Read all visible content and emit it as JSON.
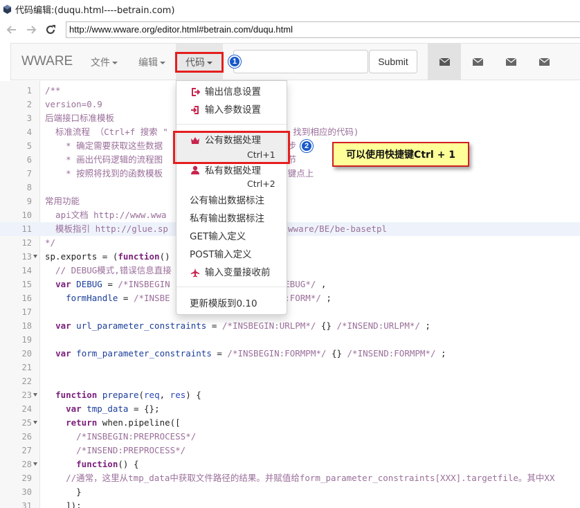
{
  "window": {
    "title": "代码编辑:(duqu.html----betrain.com)"
  },
  "browser": {
    "url": "http://www.wware.org/editor.html#betrain.com/duqu.html"
  },
  "navbar": {
    "brand": "WWARE",
    "menus": [
      "文件",
      "编辑",
      "代码"
    ],
    "search_value": "",
    "submit_label": "Submit",
    "icons": [
      "envelope-icon",
      "envelope-icon",
      "envelope-icon",
      "envelope-icon"
    ]
  },
  "dropdown": {
    "items": [
      {
        "label": "输出信息设置",
        "icon": "sign-out-icon",
        "shortcut": ""
      },
      {
        "label": "输入参数设置",
        "icon": "sign-in-icon",
        "shortcut": ""
      },
      {
        "label": "公有数据处理",
        "icon": "queen-icon",
        "shortcut": "Ctrl+1"
      },
      {
        "label": "私有数据处理",
        "icon": "user-icon",
        "shortcut": "Ctrl+2"
      },
      {
        "label": "公有输出数据标注",
        "icon": "",
        "shortcut": ""
      },
      {
        "label": "私有输出数据标注",
        "icon": "",
        "shortcut": ""
      },
      {
        "label": "GET输入定义",
        "icon": "",
        "shortcut": ""
      },
      {
        "label": "POST输入定义",
        "icon": "",
        "shortcut": ""
      },
      {
        "label": "输入变量接收前",
        "icon": "plane-icon",
        "shortcut": ""
      },
      {
        "label": "更新模版到0.10",
        "icon": "",
        "shortcut": ""
      }
    ]
  },
  "annotations": {
    "badge1": "1",
    "badge2": "2",
    "tip": "可以使用快捷键Ctrl + 1"
  },
  "editor": {
    "highlighted_line": 11,
    "lines": [
      {
        "n": "1",
        "parts": [
          [
            "c-comment",
            "/**"
          ]
        ]
      },
      {
        "n": "2",
        "parts": [
          [
            "c-comment",
            "version=0.9"
          ]
        ]
      },
      {
        "n": "3",
        "parts": [
          [
            "c-comment",
            "后端接口标准模板"
          ]
        ]
      },
      {
        "n": "4",
        "parts": [
          [
            "c-comment",
            "  标准流程 （Ctrl+f 搜索 \"                      \" 找到相应的代码)"
          ]
        ]
      },
      {
        "n": "5",
        "parts": [
          [
            "c-comment",
            "    * 确定需要获取这些数据                        步"
          ]
        ]
      },
      {
        "n": "6",
        "parts": [
          [
            "c-comment",
            "    * 画出代码逻辑的流程图                        节"
          ]
        ]
      },
      {
        "n": "7",
        "parts": [
          [
            "c-comment",
            "    * 按照将找到的函数模板                        键点上"
          ]
        ]
      },
      {
        "n": "8",
        "parts": [
          [
            "c-comment",
            ""
          ]
        ]
      },
      {
        "n": "9",
        "parts": [
          [
            "c-comment",
            "常用功能"
          ]
        ]
      },
      {
        "n": "10",
        "parts": [
          [
            "c-comment",
            "  api文档 http://www.wwa                    ml"
          ]
        ]
      },
      {
        "n": "11",
        "parts": [
          [
            "c-comment",
            "  模板指引 http://glue.sp                    ki/wware/BE/be-basetpl"
          ]
        ]
      },
      {
        "n": "12",
        "parts": [
          [
            "c-comment",
            "*/"
          ]
        ]
      },
      {
        "n": "13",
        "fold": true,
        "parts": [
          [
            "c-plain",
            "sp.exports = ("
          ],
          [
            "c-kw",
            "function"
          ],
          [
            "c-plain",
            "()"
          ]
        ]
      },
      {
        "n": "14",
        "parts": [
          [
            "c-comment",
            "  // DEBUG模式,错误信息直接"
          ]
        ]
      },
      {
        "n": "15",
        "parts": [
          [
            "c-plain",
            "  "
          ],
          [
            "c-kw",
            "var"
          ],
          [
            "c-plain",
            " "
          ],
          [
            "c-def",
            "DEBUG"
          ],
          [
            "c-plain",
            " = "
          ],
          [
            "c-comment",
            "/*INSBEGIN                 END:DEBUG*/"
          ],
          [
            "c-plain",
            " ,"
          ]
        ]
      },
      {
        "n": "16",
        "parts": [
          [
            "c-plain",
            "    "
          ],
          [
            "c-def",
            "formHandle"
          ],
          [
            "c-plain",
            " = "
          ],
          [
            "c-comment",
            "/*INSBE                 NSEND:FORM*/"
          ],
          [
            "c-plain",
            " ;"
          ]
        ]
      },
      {
        "n": "17",
        "parts": [
          [
            "c-plain",
            ""
          ]
        ]
      },
      {
        "n": "18",
        "parts": [
          [
            "c-plain",
            "  "
          ],
          [
            "c-kw",
            "var"
          ],
          [
            "c-plain",
            " "
          ],
          [
            "c-def",
            "url_parameter_constraints"
          ],
          [
            "c-plain",
            " = "
          ],
          [
            "c-comment",
            "/*INSBEGIN:URLPM*/"
          ],
          [
            "c-plain",
            " {} "
          ],
          [
            "c-comment",
            "/*INSEND:URLPM*/"
          ],
          [
            "c-plain",
            " ;"
          ]
        ]
      },
      {
        "n": "19",
        "parts": [
          [
            "c-plain",
            ""
          ]
        ]
      },
      {
        "n": "20",
        "parts": [
          [
            "c-plain",
            "  "
          ],
          [
            "c-kw",
            "var"
          ],
          [
            "c-plain",
            " "
          ],
          [
            "c-def",
            "form_parameter_constraints"
          ],
          [
            "c-plain",
            " = "
          ],
          [
            "c-comment",
            "/*INSBEGIN:FORMPM*/"
          ],
          [
            "c-plain",
            " {} "
          ],
          [
            "c-comment",
            "/*INSEND:FORMPM*/"
          ],
          [
            "c-plain",
            " ;"
          ]
        ]
      },
      {
        "n": "21",
        "parts": [
          [
            "c-plain",
            ""
          ]
        ]
      },
      {
        "n": "22",
        "parts": [
          [
            "c-plain",
            ""
          ]
        ]
      },
      {
        "n": "23",
        "fold": true,
        "parts": [
          [
            "c-plain",
            "  "
          ],
          [
            "c-kw",
            "function"
          ],
          [
            "c-plain",
            " "
          ],
          [
            "c-def",
            "prepare"
          ],
          [
            "c-plain",
            "("
          ],
          [
            "c-var",
            "req"
          ],
          [
            "c-plain",
            ", "
          ],
          [
            "c-var",
            "res"
          ],
          [
            "c-plain",
            ") {"
          ]
        ]
      },
      {
        "n": "24",
        "parts": [
          [
            "c-plain",
            "    "
          ],
          [
            "c-kw",
            "var"
          ],
          [
            "c-plain",
            " "
          ],
          [
            "c-def",
            "tmp_data"
          ],
          [
            "c-plain",
            " = {};"
          ]
        ]
      },
      {
        "n": "25",
        "fold": true,
        "parts": [
          [
            "c-plain",
            "    "
          ],
          [
            "c-kw",
            "return"
          ],
          [
            "c-plain",
            " when.pipeline(["
          ]
        ]
      },
      {
        "n": "26",
        "parts": [
          [
            "c-comment",
            "      /*INSBEGIN:PREPROCESS*/"
          ]
        ]
      },
      {
        "n": "27",
        "parts": [
          [
            "c-comment",
            "      /*INSEND:PREPROCESS*/"
          ]
        ]
      },
      {
        "n": "28",
        "fold": true,
        "parts": [
          [
            "c-plain",
            "      "
          ],
          [
            "c-kw",
            "function"
          ],
          [
            "c-plain",
            "() {"
          ]
        ]
      },
      {
        "n": "29",
        "parts": [
          [
            "c-comment",
            "    //通常，这里从tmp_data中获取文件路径的结果。并赋值给form_parameter_constraints[XXX].targetfile。其中XX"
          ]
        ]
      },
      {
        "n": "30",
        "parts": [
          [
            "c-plain",
            "      }"
          ]
        ]
      },
      {
        "n": "31",
        "parts": [
          [
            "c-plain",
            "    ]);"
          ]
        ]
      }
    ]
  }
}
